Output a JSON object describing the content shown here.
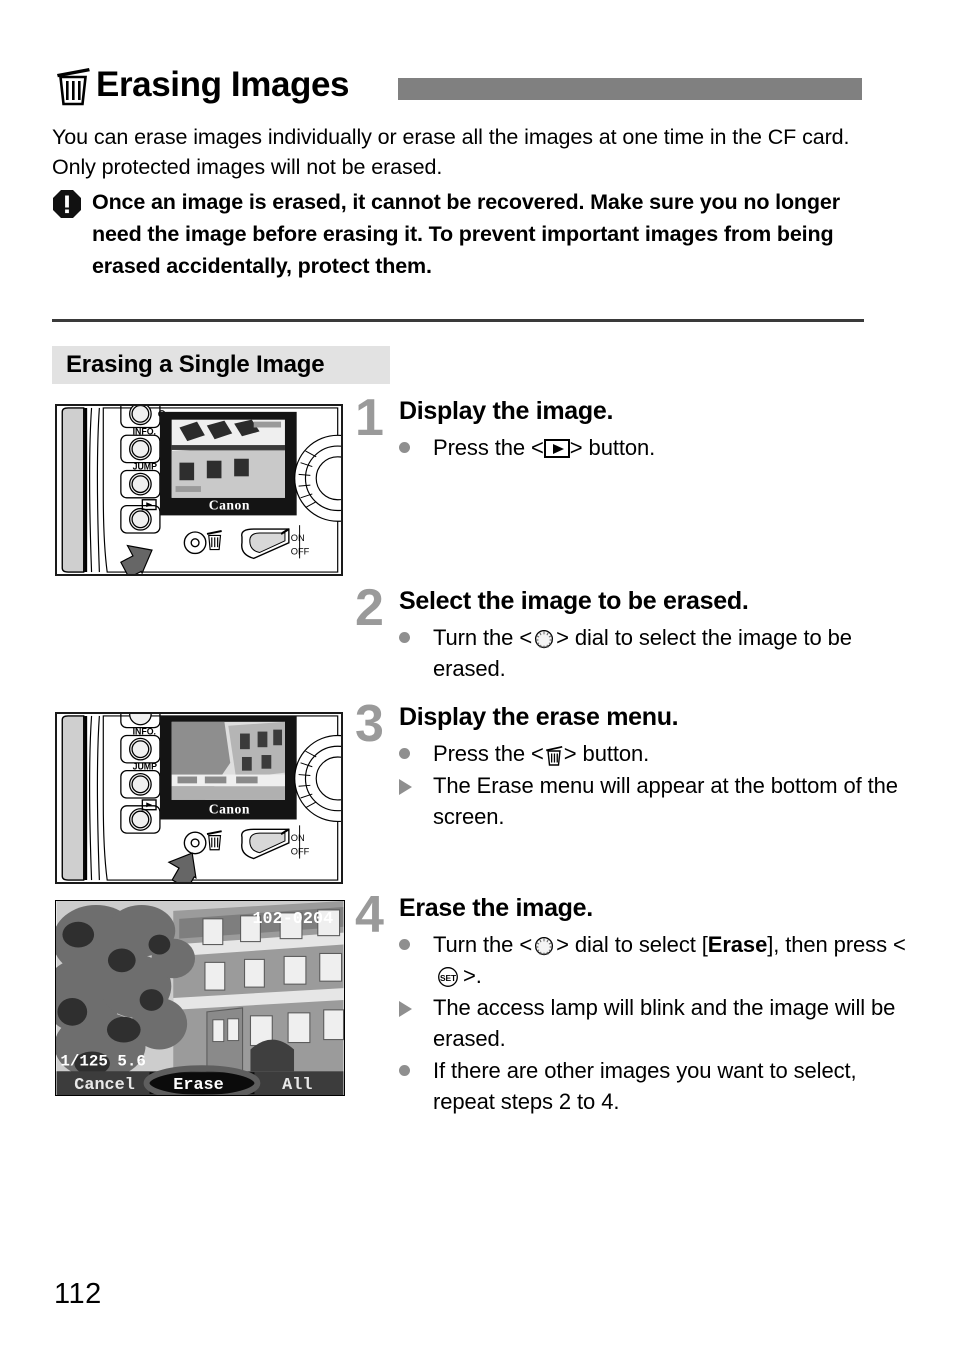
{
  "page": {
    "title": "Erasing Images",
    "title_icon": "trash-icon",
    "number": "112",
    "accent_bar_color": "#808080",
    "section_heading_bg": "#e2e2e2",
    "step_number_color": "#9a9a9a"
  },
  "intro": "You can erase images individually or erase all the images at one time in the CF card. Only protected images will not be erased.",
  "caution": {
    "icon": "warning-octagon-icon",
    "text": "Once an image is erased, it cannot be recovered. Make sure you no longer need the image before erasing it. To prevent important images from being erased accidentally, protect them."
  },
  "section": {
    "heading": "Erasing a Single Image"
  },
  "steps": [
    {
      "number": "1",
      "title": "Display the image.",
      "items": [
        {
          "marker": "dot",
          "pre": "Press the <",
          "icon": "playback-icon",
          "post": "> button."
        }
      ]
    },
    {
      "number": "2",
      "title": "Select the image to be erased.",
      "items": [
        {
          "marker": "dot",
          "pre": "Turn the <",
          "icon": "dial-icon",
          "post": "> dial to select the image to be erased."
        }
      ]
    },
    {
      "number": "3",
      "title": "Display the erase menu.",
      "items": [
        {
          "marker": "dot",
          "pre": "Press the <",
          "icon": "trash-icon",
          "post": "> button."
        },
        {
          "marker": "triangle",
          "pre": "The Erase menu will appear at the bottom of the screen.",
          "icon": "",
          "post": ""
        }
      ]
    },
    {
      "number": "4",
      "title": "Erase the image.",
      "items": [
        {
          "marker": "dot",
          "pre": "Turn the <",
          "icon": "dial-icon",
          "post": "> dial to select [",
          "bold": "Erase",
          "post2": "], then press <",
          "icon2": "set-icon",
          "post3": ">."
        },
        {
          "marker": "triangle",
          "pre": "The access lamp will blink and the image will be erased.",
          "icon": "",
          "post": ""
        },
        {
          "marker": "dot",
          "pre": "If there are other images you want to select, repeat steps 2 to 4.",
          "icon": "",
          "post": ""
        }
      ]
    }
  ],
  "figures": {
    "camera_back_1": {
      "name": "camera-back-playback-button",
      "brand": "Canon",
      "labels": [
        "INFO.",
        "JUMP"
      ],
      "power_labels": [
        "ON",
        "OFF"
      ],
      "arrow_target": "playback-button"
    },
    "camera_back_3": {
      "name": "camera-back-erase-button",
      "brand": "Canon",
      "labels": [
        "INFO.",
        "JUMP"
      ],
      "power_labels": [
        "ON",
        "OFF"
      ],
      "arrow_target": "erase-button"
    },
    "lcd_erase_menu": {
      "name": "lcd-erase-menu",
      "image_number": "102-0204",
      "shutter_speed": "1/125",
      "aperture": "5.6",
      "menu_options": [
        "Cancel",
        "Erase",
        "All"
      ],
      "selected_option": "Erase"
    }
  }
}
